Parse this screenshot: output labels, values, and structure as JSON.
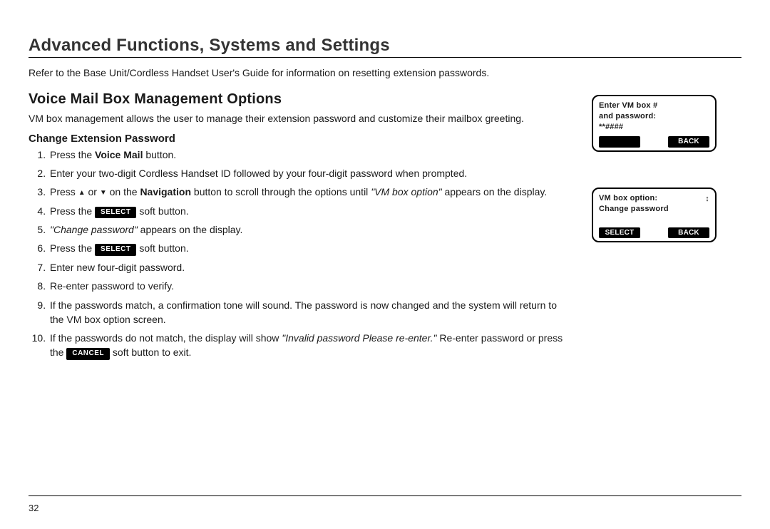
{
  "section_title": "Advanced Functions, Systems and Settings",
  "intro": "Refer to the Base Unit/Cordless Handset User's Guide for information on resetting extension passwords.",
  "sub_title": "Voice Mail Box Management Options",
  "sub_desc": "VM box management allows the user to manage their extension password and customize their mailbox greeting.",
  "minor_title": "Change Extension Password",
  "steps": {
    "s1_a": "Press the ",
    "s1_b": "Voice Mail",
    "s1_c": " button.",
    "s2": "Enter your two-digit Cordless Handset ID followed by your four-digit password when prompted.",
    "s3_a": "Press ",
    "s3_b": " or ",
    "s3_c": " on the ",
    "s3_nav": "Navigation",
    "s3_d": " button to scroll through the options until ",
    "s3_quote": "\"VM box option\"",
    "s3_e": " appears on the display.",
    "s4_a": "Press the ",
    "s4_btn": "SELECT",
    "s4_b": " soft button.",
    "s5_quote": "\"Change password\"",
    "s5_a": " appears on the display.",
    "s6_a": "Press the ",
    "s6_btn": "SELECT",
    "s6_b": " soft button.",
    "s7": "Enter new four-digit password.",
    "s8": "Re-enter password to verify.",
    "s9": "If the passwords match, a confirmation tone will sound. The password is now changed and the system will return to the VM box option screen.",
    "s10_a": "If the passwords do not match, the display will show ",
    "s10_quote": "\"Invalid password Please re-enter.\"",
    "s10_b": " Re-enter password or press the ",
    "s10_btn": "CANCEL",
    "s10_c": " soft button to exit."
  },
  "screen1": {
    "line1": "Enter VM box #",
    "line2": "and password:",
    "line3": "**####",
    "soft_left": "",
    "soft_right": "BACK"
  },
  "screen2": {
    "line1": "VM box option:",
    "line2": "Change password",
    "soft_left": "SELECT",
    "soft_right": "BACK",
    "updown": "↕"
  },
  "page_number": "32"
}
